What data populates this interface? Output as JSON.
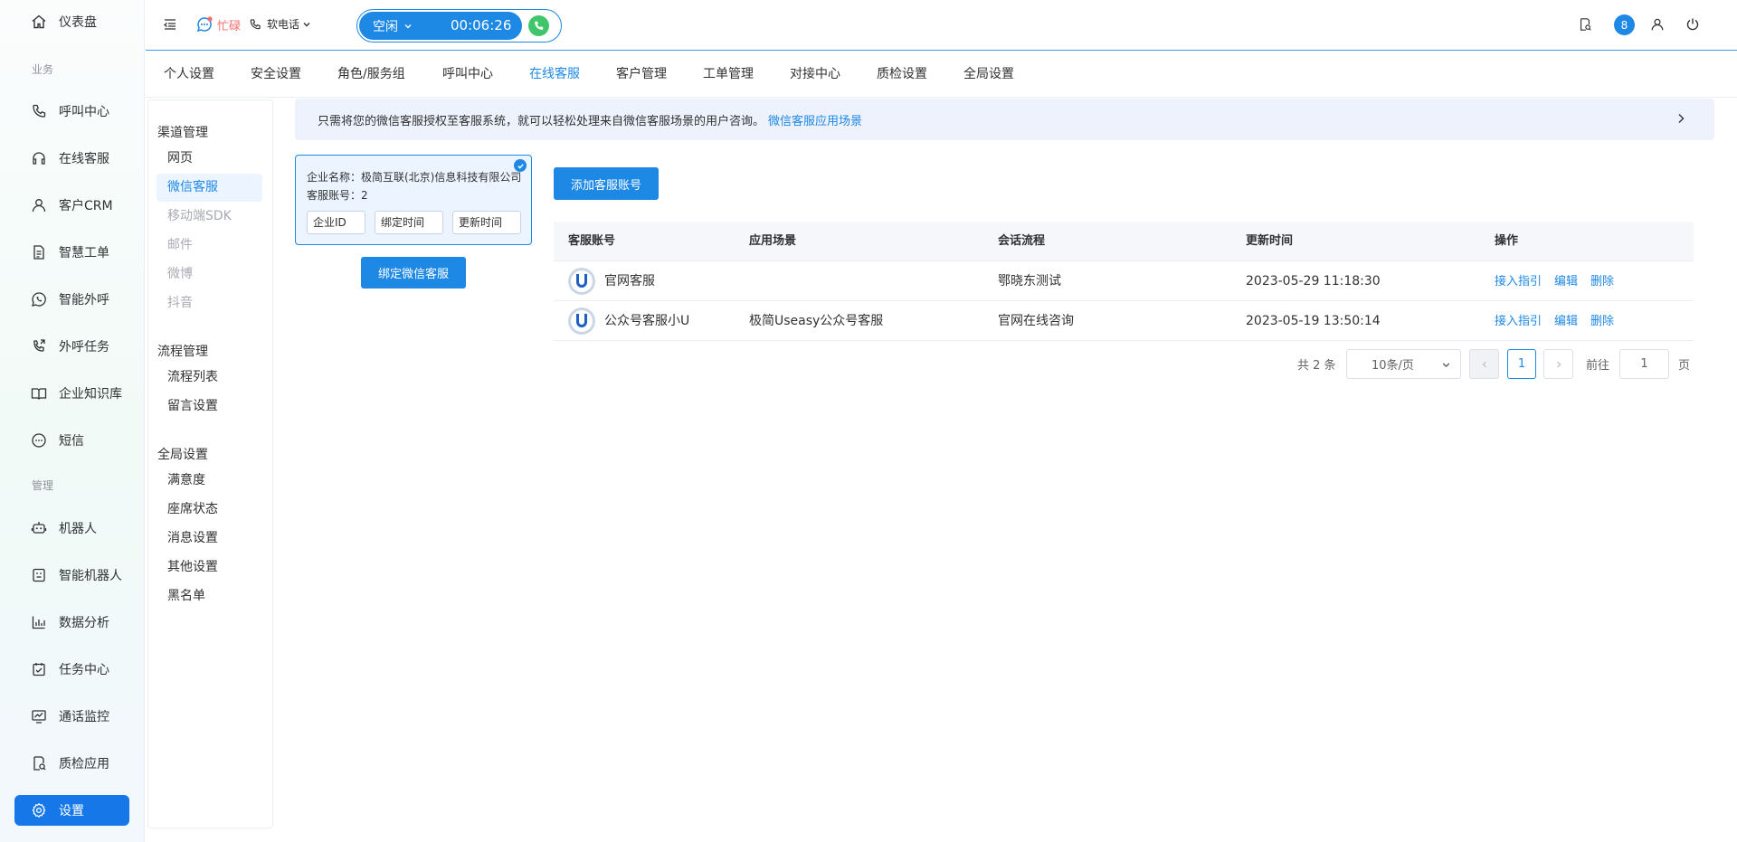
{
  "sidebar": {
    "items": [
      {
        "label": "仪表盘",
        "icon": "home-icon"
      },
      {
        "label": "呼叫中心",
        "icon": "phone-icon"
      },
      {
        "label": "在线客服",
        "icon": "headset-icon"
      },
      {
        "label": "客户CRM",
        "icon": "user-icon"
      },
      {
        "label": "智慧工单",
        "icon": "document-icon"
      },
      {
        "label": "智能外呼",
        "icon": "whatsapp-icon"
      },
      {
        "label": "外呼任务",
        "icon": "phone-outgoing-icon"
      },
      {
        "label": "企业知识库",
        "icon": "book-icon"
      },
      {
        "label": "短信",
        "icon": "sms-icon"
      },
      {
        "label": "机器人",
        "icon": "robot-icon"
      },
      {
        "label": "智能机器人",
        "icon": "smart-robot-icon"
      },
      {
        "label": "数据分析",
        "icon": "bar-chart-icon"
      },
      {
        "label": "任务中心",
        "icon": "task-check-icon"
      },
      {
        "label": "通话监控",
        "icon": "monitor-icon"
      },
      {
        "label": "质检应用",
        "icon": "inspection-icon"
      },
      {
        "label": "设置",
        "icon": "gear-icon",
        "active": true
      }
    ],
    "groups": {
      "business": "业务",
      "manage": "管理"
    }
  },
  "header": {
    "busy_label": "忙碌",
    "phone_label": "软电话",
    "status_label": "空闲",
    "timer": "00:06:26",
    "badge_count": "8"
  },
  "tabs": [
    {
      "label": "个人设置"
    },
    {
      "label": "安全设置"
    },
    {
      "label": "角色/服务组"
    },
    {
      "label": "呼叫中心"
    },
    {
      "label": "在线客服",
      "active": true
    },
    {
      "label": "客户管理"
    },
    {
      "label": "工单管理"
    },
    {
      "label": "对接中心"
    },
    {
      "label": "质检设置"
    },
    {
      "label": "全局设置"
    }
  ],
  "submenu": {
    "groups": [
      {
        "title": "渠道管理",
        "items": [
          {
            "label": "网页"
          },
          {
            "label": "微信客服",
            "active": true
          },
          {
            "label": "移动端SDK",
            "disabled": true
          },
          {
            "label": "邮件",
            "disabled": true
          },
          {
            "label": "微博",
            "disabled": true
          },
          {
            "label": "抖音",
            "disabled": true
          }
        ]
      },
      {
        "title": "流程管理",
        "items": [
          {
            "label": "流程列表"
          },
          {
            "label": "留言设置"
          }
        ]
      },
      {
        "title": "全局设置",
        "items": [
          {
            "label": "满意度"
          },
          {
            "label": "座席状态"
          },
          {
            "label": "消息设置"
          },
          {
            "label": "其他设置"
          },
          {
            "label": "黑名单"
          }
        ]
      }
    ]
  },
  "banner": {
    "text": "只需将您的微信客服授权至客服系统，就可以轻松处理来自微信客服场景的用户咨询。",
    "link": "微信客服应用场景"
  },
  "corp_card": {
    "name_line": "企业名称：极简互联(北京)信息科技有限公司",
    "account_line": "客服账号：2",
    "chips": [
      "企业ID",
      "绑定时间",
      "更新时间"
    ]
  },
  "bind_button": "绑定微信客服",
  "add_button": "添加客服账号",
  "table": {
    "headers": [
      "客服账号",
      "应用场景",
      "会话流程",
      "更新时间",
      "操作"
    ],
    "rows": [
      {
        "account": "官网客服",
        "scene": "",
        "flow": "鄂晓东测试",
        "updated": "2023-05-29 11:18:30"
      },
      {
        "account": "公众号客服小U",
        "scene": "极简Useasy公众号客服",
        "flow": "官网在线咨询",
        "updated": "2023-05-19 13:50:14"
      }
    ],
    "actions": [
      "接入指引",
      "编辑",
      "删除"
    ]
  },
  "pagination": {
    "total": "共 2 条",
    "page_size": "10条/页",
    "current_page": "1",
    "goto_label": "前往",
    "goto_value": "1",
    "page_suffix": "页"
  }
}
